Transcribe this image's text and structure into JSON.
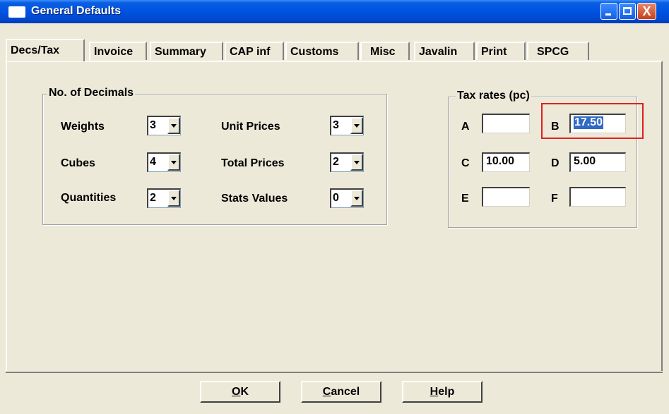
{
  "window": {
    "title": "General Defaults",
    "controls": {
      "close_glyph": "X"
    }
  },
  "tabs": [
    {
      "label": "Decs/Tax",
      "active": true
    },
    {
      "label": "Invoice"
    },
    {
      "label": "Summary"
    },
    {
      "label": "CAP inf"
    },
    {
      "label": "Customs"
    },
    {
      "label": "Misc"
    },
    {
      "label": "Javalin"
    },
    {
      "label": "Print"
    },
    {
      "label": "SPCG"
    }
  ],
  "decimals": {
    "legend": "No. of Decimals",
    "weights": {
      "label": "Weights",
      "value": "3"
    },
    "cubes": {
      "label": "Cubes",
      "value": "4"
    },
    "quantities": {
      "label": "Quantities",
      "value": "2"
    },
    "unit_prices": {
      "label": "Unit Prices",
      "value": "3"
    },
    "total_prices": {
      "label": "Total Prices",
      "value": "2"
    },
    "stats_values": {
      "label": "Stats Values",
      "value": "0"
    }
  },
  "tax": {
    "legend": "Tax rates (pc)",
    "a": {
      "label": "A",
      "value": ""
    },
    "b": {
      "label": "B",
      "value": "17.50",
      "selected": true
    },
    "c": {
      "label": "C",
      "value": "10.00"
    },
    "d": {
      "label": "D",
      "value": "5.00"
    },
    "e": {
      "label": "E",
      "value": ""
    },
    "f": {
      "label": "F",
      "value": ""
    }
  },
  "buttons": {
    "ok": {
      "mnemonic": "O",
      "rest": "K"
    },
    "cancel": {
      "mnemonic": "C",
      "rest": "ancel"
    },
    "help": {
      "mnemonic": "H",
      "rest": "elp"
    }
  },
  "colors": {
    "titlebar": "#0054e3",
    "selection": "#316ac5",
    "highlight_box": "#e02020",
    "dialog_bg": "#ece9d8"
  }
}
